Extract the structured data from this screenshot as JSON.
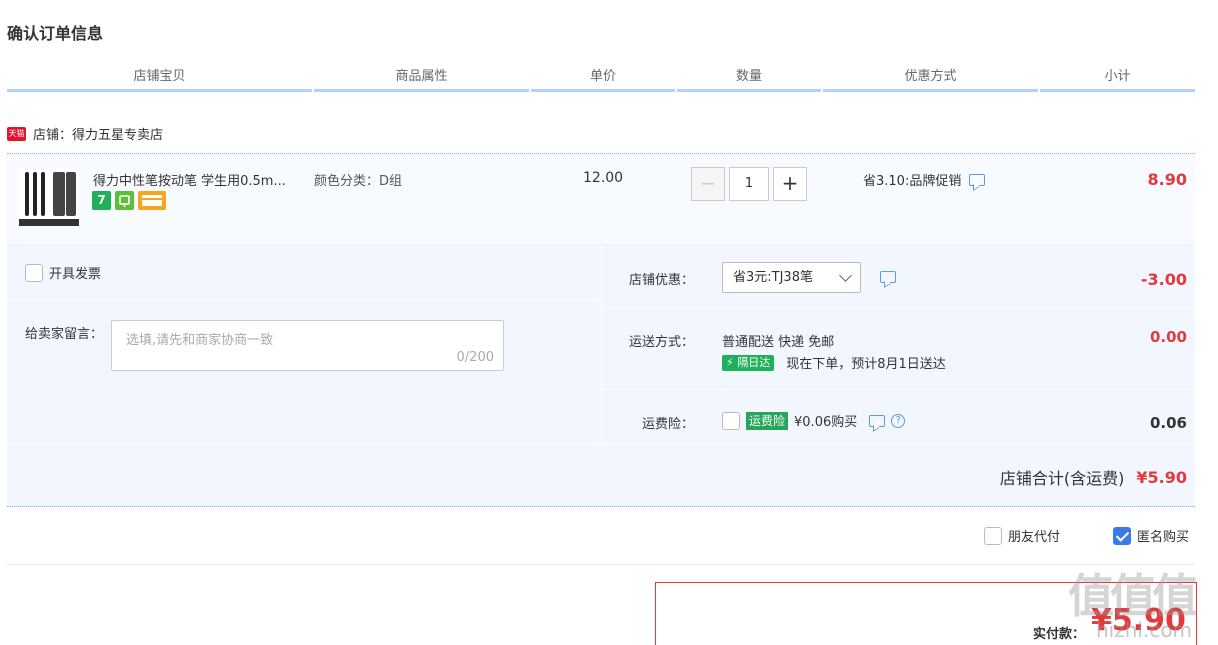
{
  "page": {
    "title": "确认订单信息"
  },
  "columns": [
    "店铺宝贝",
    "商品属性",
    "单价",
    "数量",
    "优惠方式",
    "小计"
  ],
  "shop": {
    "badge": "天猫",
    "label": "店铺：得力五星专卖店"
  },
  "item": {
    "title": "得力中性笔按动笔 学生用0.5m...",
    "service_icons": [
      "7",
      "",
      ""
    ],
    "attribute": "颜色分类：D组",
    "price": "12.00",
    "qty_minus": "−",
    "quantity": "1",
    "qty_plus": "+",
    "promo": "省3.10:品牌促销",
    "subtotal": "8.90"
  },
  "options": {
    "invoice_label": "开具发票",
    "message_label": "给卖家留言：",
    "message_placeholder": "选填,请先和商家协商一致",
    "message_count": "0/200",
    "shop_coupon_label": "店铺优惠：",
    "shop_coupon_value": "省3元:TJ38笔",
    "shop_coupon_amount": "-3.00",
    "shipping_label": "运送方式：",
    "shipping_method": "普通配送 快递 免邮",
    "shipping_badge": "隔日达",
    "shipping_eta": "现在下单，预计8月1日送达",
    "shipping_amount": "0.00",
    "insurance_label": "运费险：",
    "insurance_badge": "运费险",
    "insurance_price": "¥0.06购买",
    "insurance_amount": "0.06"
  },
  "shop_total": {
    "label": "店铺合计(含运费)",
    "amount": "¥5.90"
  },
  "pay_options": {
    "friend_pay": {
      "label": "朋友代付",
      "checked": false
    },
    "anonymous": {
      "label": "匿名购买",
      "checked": true
    }
  },
  "payment": {
    "label": "实付款：",
    "amount": "¥5.90"
  },
  "watermark": {
    "mark": "值值值",
    "sub": "hizhi.com"
  },
  "colors": {
    "accent": "#e4393c",
    "header_line": "#b2d1ff",
    "panel_bg": "#f2f7ff",
    "check_blue": "#3a7be8"
  }
}
